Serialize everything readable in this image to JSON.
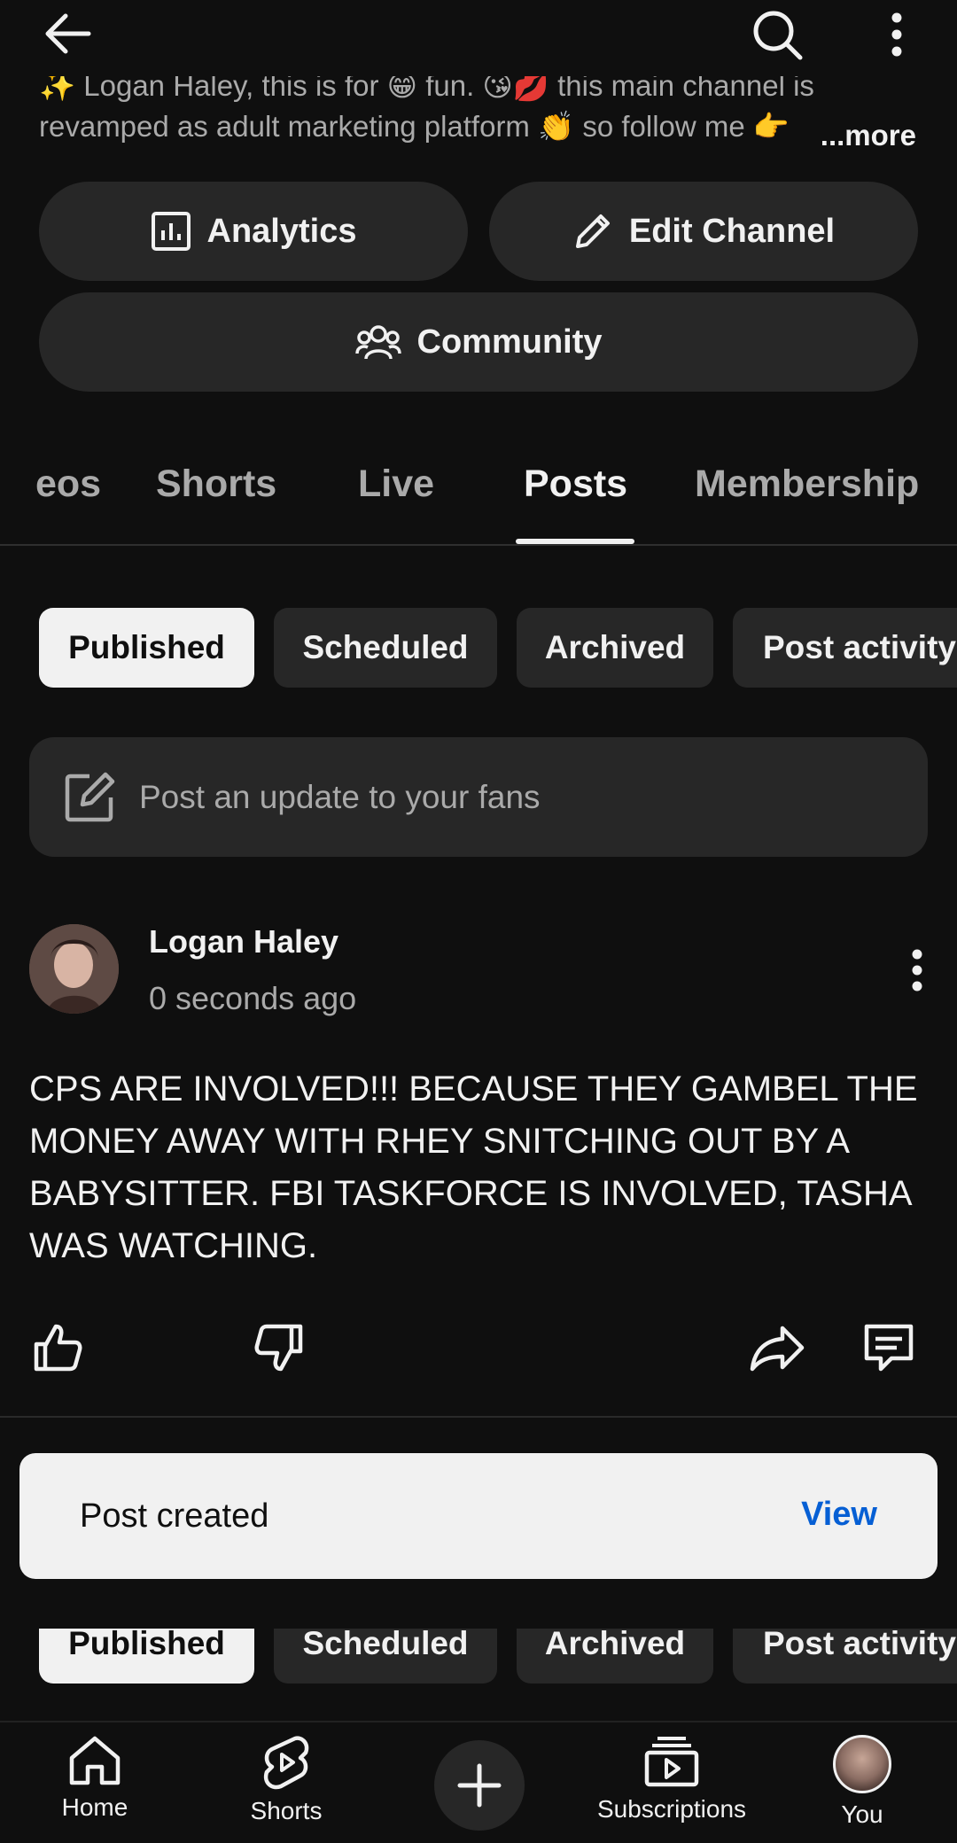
{
  "header": {
    "back_icon": "arrow-left-icon",
    "search_icon": "search-icon",
    "more_icon": "kebab-vertical-icon"
  },
  "description": {
    "line1": "✨ Logan Haley, this is for 😁 fun. 😘💋 this main channel is",
    "line2": "revamped as adult marketing platform 👏 so follow me 👉",
    "more_label": "...more"
  },
  "actions": {
    "analytics_label": "Analytics",
    "edit_label": "Edit Channel",
    "community_label": "Community"
  },
  "tabs": [
    {
      "label": "eos"
    },
    {
      "label": "Shorts"
    },
    {
      "label": "Live"
    },
    {
      "label": "Posts",
      "active": true
    },
    {
      "label": "Membership"
    }
  ],
  "chips": [
    {
      "label": "Published",
      "selected": true
    },
    {
      "label": "Scheduled"
    },
    {
      "label": "Archived"
    },
    {
      "label": "Post activity"
    }
  ],
  "composer": {
    "placeholder": "Post an update to your fans"
  },
  "post": {
    "author": "Logan Haley",
    "time": "0 seconds ago",
    "body": "CPS ARE INVOLVED!!! BECAUSE THEY GAMBEL THE MONEY AWAY WITH RHEY SNITCHING OUT BY A BABYSITTER.  FBI TASKFORCE IS INVOLVED, TASHA WAS WATCHING."
  },
  "snackbar": {
    "message": "Post created",
    "action": "View"
  },
  "bottom_nav": [
    {
      "label": "Home",
      "icon": "home-icon"
    },
    {
      "label": "Shorts",
      "icon": "shorts-icon"
    },
    {
      "label": "",
      "icon": "create-plus-icon"
    },
    {
      "label": "Subscriptions",
      "icon": "subscriptions-icon"
    },
    {
      "label": "You",
      "icon": "avatar"
    }
  ],
  "colors": {
    "background": "#0f0f0f",
    "surface": "#272727",
    "text_primary": "#f1f1f1",
    "text_secondary": "#aaaaaa",
    "link_blue": "#065fd4"
  }
}
